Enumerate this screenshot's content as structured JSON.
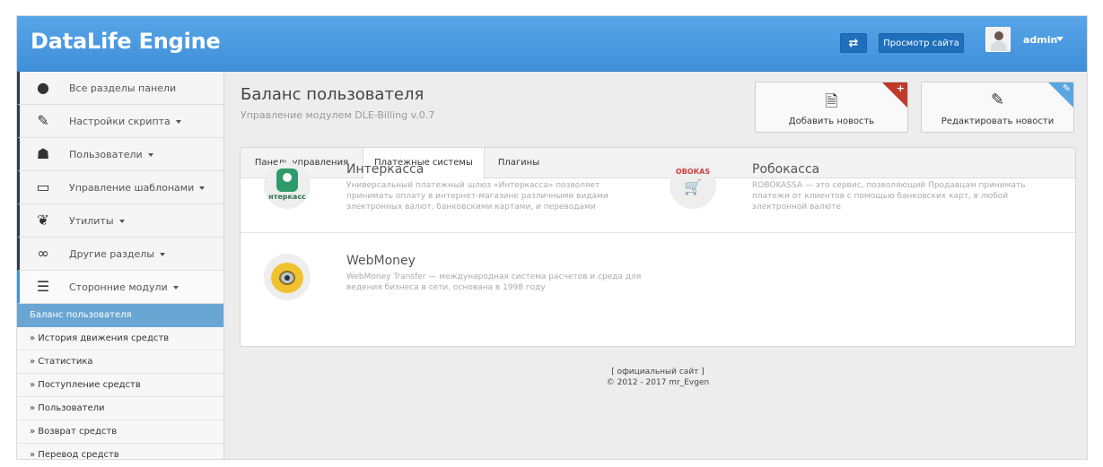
{
  "header": {
    "brand": "DataLife Engine",
    "swap_icon_glyph": "⇄",
    "view_site_label": "Просмотр сайта",
    "user_name": "admin"
  },
  "sidebar": {
    "items": [
      {
        "label": "Все разделы панели",
        "icon": "globe-icon",
        "glyph": "●"
      },
      {
        "label": "Настройки скрипта",
        "icon": "wrench-icon",
        "glyph": "✎"
      },
      {
        "label": "Пользователи",
        "icon": "user-icon",
        "glyph": "☗"
      },
      {
        "label": "Управление шаблонами",
        "icon": "laptop-icon",
        "glyph": "▭"
      },
      {
        "label": "Утилиты",
        "icon": "leaf-icon",
        "glyph": "❦"
      },
      {
        "label": "Другие разделы",
        "icon": "link-icon",
        "glyph": "∞"
      },
      {
        "label": "Сторонние модули",
        "icon": "list-icon",
        "glyph": "☰"
      }
    ],
    "active_sub": "Баланс пользователя",
    "sub_items": [
      "» История движения средств",
      "» Статистика",
      "» Поступление средств",
      "» Пользователи",
      "» Возврат средств",
      "» Перевод средств"
    ]
  },
  "page": {
    "title": "Баланс пользователя",
    "subtitle": "Управление модулем DLE-Billing v.0.7"
  },
  "actions": {
    "add_label": "Добавить новость",
    "add_glyph": "🗎",
    "edit_label": "Редактировать новости",
    "edit_glyph": "✎",
    "add_corner": "+",
    "edit_corner": "✎"
  },
  "tabs": [
    "Панель управления",
    "Платежные системы",
    "Плагины"
  ],
  "systems": {
    "interkassa": {
      "name": "Интеркасса",
      "desc": "Универсальный платежный шлюз «Интеркасса» позволяет принимать оплату в интернет-магазине различными видами электронных валют, банковскими картами, и переводами",
      "logo_text": "нтеркасс"
    },
    "robokassa": {
      "name": "Робокасса",
      "desc": "ROBOKASSA — это сервис, позволяющий Продавцам принимать платежи от клиентов с помощью банковских карт, в любой электронной валюте",
      "logo_text": "ОВОКАS"
    },
    "webmoney": {
      "name": "WebMoney",
      "desc": "WebMoney Transfer — международная система расчетов и среда для ведения бизнеса в сети, основана в 1998 году"
    }
  },
  "footer": {
    "link": "[ официальный сайт ]",
    "copyright": "© 2012 - 2017 mr_Evgen"
  },
  "colors": {
    "header": "#3f8fda",
    "active_sub": "#6aa6d3",
    "add_corner": "#c0392b",
    "edit_corner": "#5aa6e0"
  }
}
